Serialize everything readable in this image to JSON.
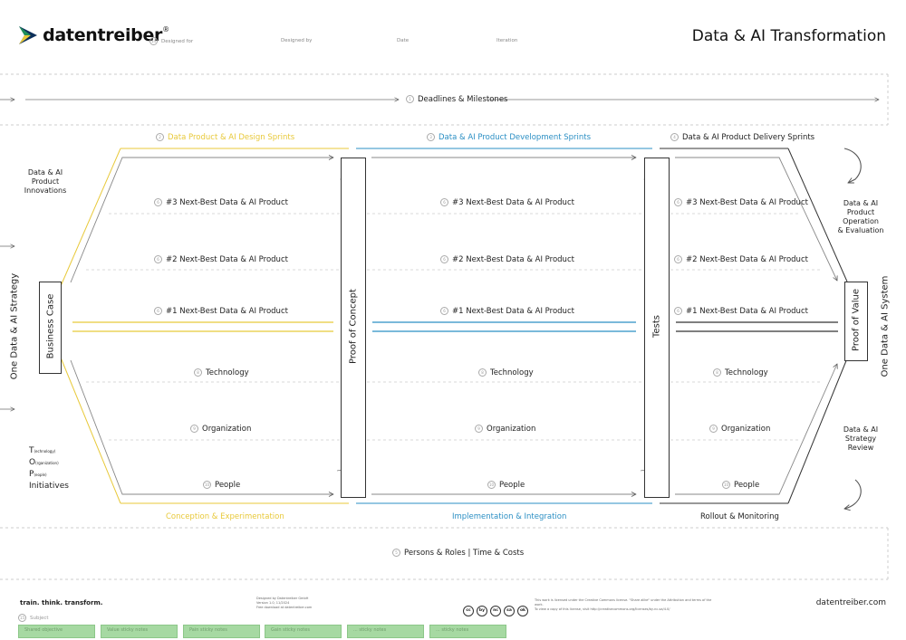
{
  "header": {
    "brand": "datentreiber",
    "brand_mark": "®",
    "title": "Data & AI Transformation",
    "fields": [
      "Designed for",
      "Designed by",
      "Date",
      "Iteration"
    ]
  },
  "timeline": {
    "label": "Deadlines & Milestones",
    "num": "1"
  },
  "stages": {
    "design": {
      "top": "Data Product & AI Design Sprints",
      "bottom": "Conception & Experimentation",
      "num": "2"
    },
    "develop": {
      "top": "Data & AI Product Development Sprints",
      "bottom": "Implementation & Integration",
      "num": "3"
    },
    "delivery": {
      "top": "Data & AI Product Delivery Sprints",
      "bottom": "Rollout & Monitoring",
      "num": "4"
    }
  },
  "rows": {
    "p3": "#3 Next-Best Data & AI Product",
    "p2": "#2 Next-Best Data & AI Product",
    "p1": "#1 Next-Best Data & AI Product",
    "tech": "Technology",
    "org": "Organization",
    "people": "People"
  },
  "boxes": {
    "business_case": "Business Case",
    "proof_concept": "Proof of Concept",
    "tests": "Tests",
    "proof_value": "Proof of Value"
  },
  "left": {
    "strategy": "One Data & AI Strategy",
    "innovations": [
      "Data & AI",
      "Product",
      "Innovations"
    ],
    "todp": [
      {
        "big": "T",
        "small": "(echnology)"
      },
      {
        "big": "O",
        "small": "(rganization)"
      },
      {
        "big": "P",
        "small": "(eople)"
      }
    ],
    "initiatives": "Initiatives"
  },
  "right": {
    "system": "One Data & AI System",
    "operation": [
      "Data & AI",
      "Product",
      "Operation",
      "& Evaluation"
    ],
    "review": [
      "Data & AI",
      "Strategy",
      "Review"
    ]
  },
  "bottom_band": {
    "label": "Persons & Roles | Time & Costs",
    "num": "5"
  },
  "footer": {
    "tagline": "train. think. transform.",
    "credit": [
      "Designed by Datentreiber GmbH",
      "Version 1.0, 11/2024",
      "Free download at datentreiber.com"
    ],
    "license_icons": [
      "cc",
      "by",
      "nc",
      "sa",
      "ok"
    ],
    "license_text": [
      "This work is licensed under the Creative Commons license. \"Share alike\" under the Attribution and terms of the work.",
      "To view a copy of this license, visit http://creativecommons.org/licenses/by-nc-sa/4.0/"
    ],
    "site": "datentreiber.com",
    "subject": "Subject",
    "stickies": [
      "Shared objective",
      "Value sticky notes",
      "Pain sticky notes",
      "Gain sticky notes",
      "... sticky notes"
    ]
  },
  "colors": {
    "design": "#e8c93a",
    "develop": "#2b8fc4",
    "delivery": "#333333"
  }
}
